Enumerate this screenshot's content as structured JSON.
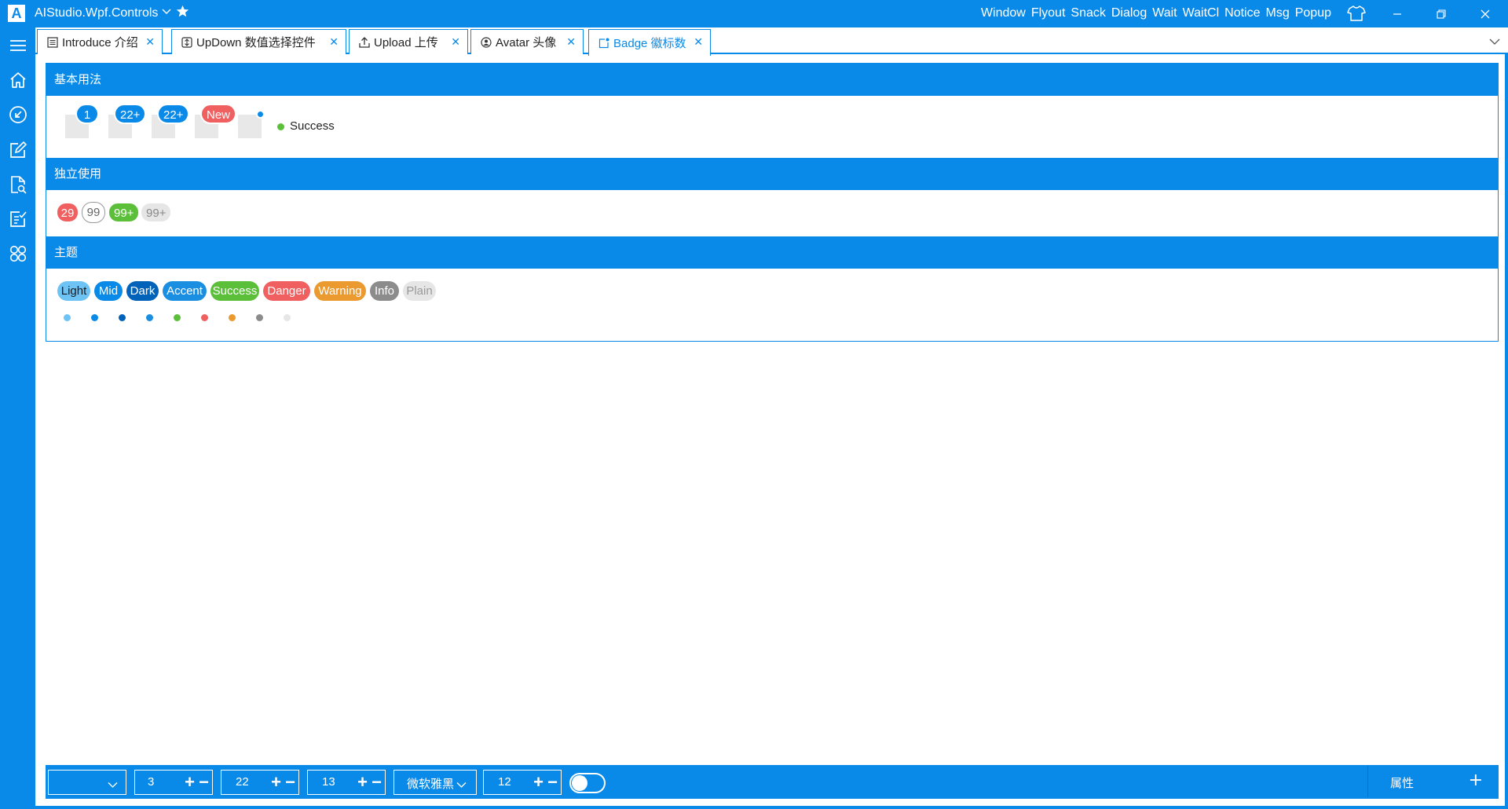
{
  "titlebar": {
    "logo": "A",
    "title": "AIStudio.Wpf.Controls",
    "menu": [
      "Window",
      "Flyout",
      "Snack",
      "Dialog",
      "Wait",
      "WaitCl",
      "Notice",
      "Msg",
      "Popup"
    ]
  },
  "sidebar": {
    "icons": [
      "hamburger-menu-icon",
      "home-icon",
      "compass-icon",
      "edit-icon",
      "file-search-icon",
      "checklist-icon",
      "apps-icon"
    ]
  },
  "tabs": [
    {
      "label": "Introduce 介绍",
      "icon": "document-icon",
      "active": false
    },
    {
      "label": "UpDown 数值选择控件",
      "icon": "updown-icon",
      "active": false
    },
    {
      "label": "Upload 上传",
      "icon": "upload-icon",
      "active": false
    },
    {
      "label": "Avatar 头像",
      "icon": "avatar-icon",
      "active": false
    },
    {
      "label": "Badge 徽标数",
      "icon": "badge-icon",
      "active": true
    }
  ],
  "sections": {
    "basic": {
      "title": "基本用法",
      "badges": [
        "1",
        "22+",
        "22+",
        "New"
      ],
      "status_text": "Success"
    },
    "standalone": {
      "title": "独立使用",
      "badges": [
        "29",
        "99",
        "99+",
        "99+"
      ]
    },
    "theme": {
      "title": "主题",
      "pills": [
        "Light",
        "Mid",
        "Dark",
        "Accent",
        "Success",
        "Danger",
        "Warning",
        "Info",
        "Plain"
      ],
      "colors": [
        "#6ec3f5",
        "#0a8ae8",
        "#0062b8",
        "#1a8ee0",
        "#5cbf3a",
        "#f06060",
        "#eb9a30",
        "#8c8c8c",
        "#e6e6e6"
      ]
    }
  },
  "bottombar": {
    "dropdown_value": "",
    "num1": "3",
    "num2": "22",
    "num3": "13",
    "font": "微软雅黑",
    "font_size": "12",
    "toggle_on": false,
    "properties_label": "属性"
  }
}
